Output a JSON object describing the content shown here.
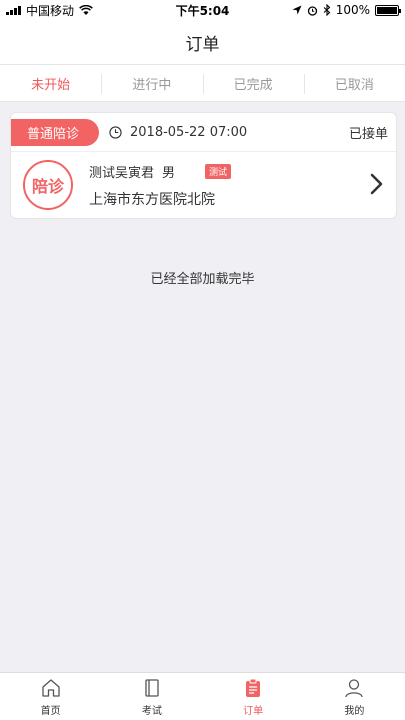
{
  "status_bar": {
    "carrier": "中国移动",
    "time": "下午5:04",
    "battery": "100%"
  },
  "nav": {
    "title": "订单"
  },
  "tabs": [
    {
      "label": "未开始",
      "active": true
    },
    {
      "label": "进行中",
      "active": false
    },
    {
      "label": "已完成",
      "active": false
    },
    {
      "label": "已取消",
      "active": false
    }
  ],
  "orders": [
    {
      "service": "普通陪诊",
      "datetime": "2018-05-22 07:00",
      "status": "已接单",
      "badge": "陪诊",
      "name": "测试吴寅君",
      "gender": "男",
      "tag": "测试",
      "address": "上海市东方医院北院"
    }
  ],
  "loaded_text": "已经全部加载完毕",
  "bottom_nav": [
    {
      "label": "首页",
      "icon": "home-icon",
      "active": false
    },
    {
      "label": "考试",
      "icon": "book-icon",
      "active": false
    },
    {
      "label": "订单",
      "icon": "clipboard-icon",
      "active": true
    },
    {
      "label": "我的",
      "icon": "person-icon",
      "active": false
    }
  ],
  "colors": {
    "accent": "#f26464",
    "background": "#efeff4"
  }
}
